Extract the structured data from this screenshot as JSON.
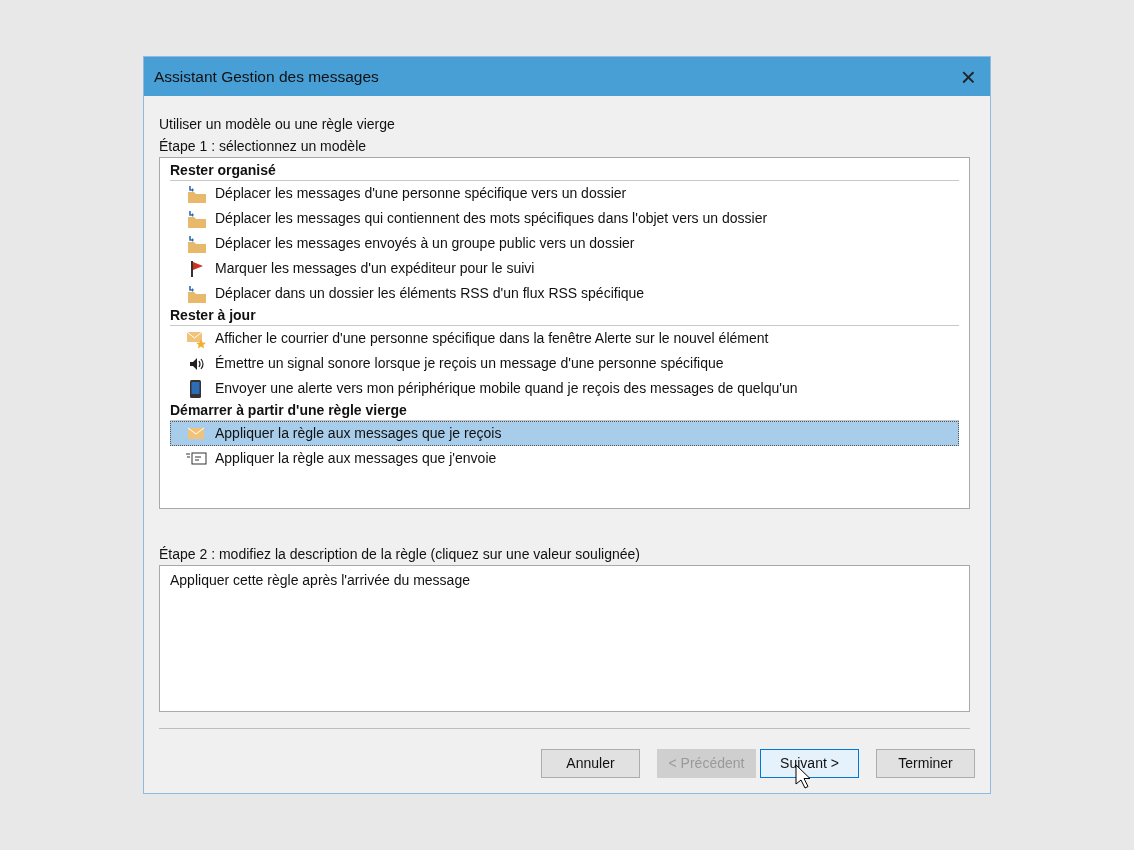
{
  "window": {
    "title": "Assistant Gestion des messages",
    "close": "×"
  },
  "intro": "Utiliser un modèle ou une règle vierge",
  "step1": "Étape 1 : sélectionnez un modèle",
  "groups": [
    {
      "heading": "Rester organisé",
      "items": [
        {
          "kind": "folder-move",
          "label": "Déplacer les messages d'une personne spécifique vers un dossier",
          "selected": false
        },
        {
          "kind": "folder-move",
          "label": "Déplacer les messages qui contiennent des mots spécifiques dans l'objet vers un dossier",
          "selected": false
        },
        {
          "kind": "folder-move",
          "label": "Déplacer les messages envoyés à un groupe public vers un dossier",
          "selected": false
        },
        {
          "kind": "flag",
          "label": "Marquer les messages d'un expéditeur pour le suivi",
          "selected": false
        },
        {
          "kind": "folder-move",
          "label": "Déplacer dans un dossier les éléments RSS d'un flux RSS spécifique",
          "selected": false
        }
      ]
    },
    {
      "heading": "Rester à jour",
      "items": [
        {
          "kind": "mail-star",
          "label": "Afficher le courrier d'une personne spécifique dans la fenêtre Alerte sur le nouvel élément",
          "selected": false
        },
        {
          "kind": "speaker",
          "label": "Émettre un signal sonore lorsque je reçois un message d'une personne spécifique",
          "selected": false
        },
        {
          "kind": "phone",
          "label": "Envoyer une alerte vers mon périphérique mobile quand je reçois des messages de quelqu'un",
          "selected": false
        }
      ]
    },
    {
      "heading": "Démarrer à partir d'une règle vierge",
      "items": [
        {
          "kind": "mail",
          "label": "Appliquer la règle aux messages que je reçois",
          "selected": true
        },
        {
          "kind": "mail-send",
          "label": "Appliquer la règle aux messages que j'envoie",
          "selected": false
        }
      ]
    }
  ],
  "step2": "Étape 2 : modifiez la description de la règle (cliquez sur une valeur soulignée)",
  "description": "Appliquer cette règle après l'arrivée du message",
  "buttons": [
    {
      "label": "Annuler",
      "disabled": false,
      "default": false
    },
    {
      "label": "< Précédent",
      "disabled": true,
      "default": false
    },
    {
      "label": "Suivant >",
      "disabled": false,
      "default": true,
      "pointer": true
    },
    {
      "label": "Terminer",
      "disabled": false,
      "default": false
    }
  ]
}
